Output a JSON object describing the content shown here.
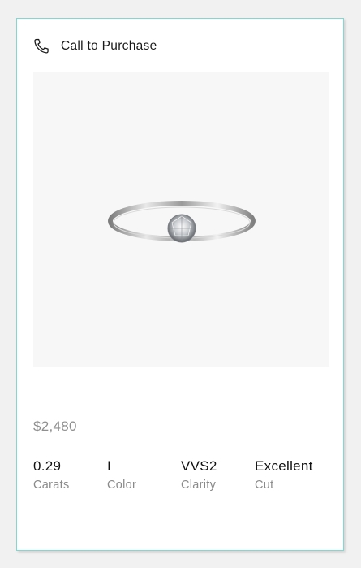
{
  "card": {
    "call_label": "Call to Purchase",
    "product_image_icon": "solitaire-ring-image",
    "price": "$2,480",
    "specs": [
      {
        "value": "0.29",
        "label": "Carats"
      },
      {
        "value": "I",
        "label": "Color"
      },
      {
        "value": "VVS2",
        "label": "Clarity"
      },
      {
        "value": "Excellent",
        "label": "Cut"
      }
    ]
  },
  "colors": {
    "card_border": "#81d8d0",
    "price_text": "#8f8f8f",
    "label_text": "#8a8a8a",
    "image_bg": "#f7f7f7"
  }
}
